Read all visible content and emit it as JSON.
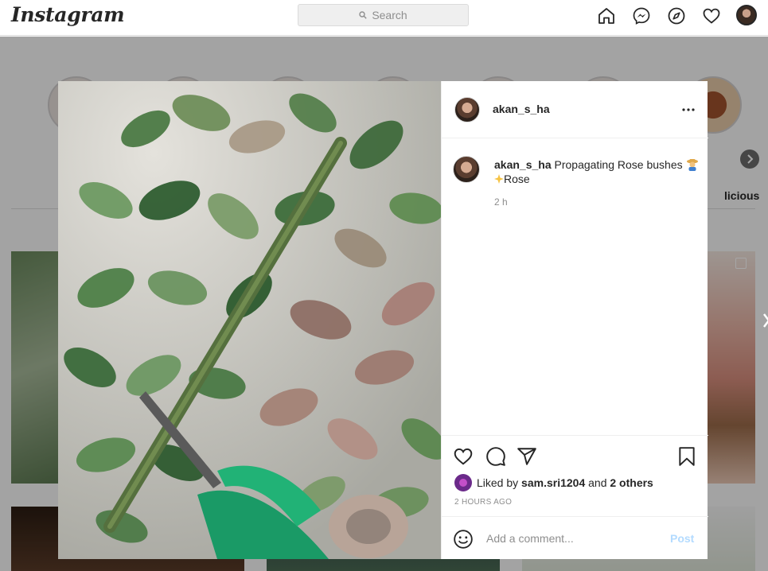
{
  "header": {
    "logo": "Instagram",
    "search_placeholder": "Search",
    "icons": [
      "home-icon",
      "messenger-icon",
      "explore-icon",
      "heart-icon",
      "profile-avatar"
    ]
  },
  "stories": {
    "partial_label": "licious"
  },
  "post": {
    "username": "akan_s_ha",
    "caption": {
      "username": "akan_s_ha",
      "text": "Propagating Rose bushes",
      "emoji1": "farmer-emoji",
      "line2": "Rose",
      "emoji2": "sparkles-emoji",
      "time": "2 h"
    },
    "likes": {
      "prefix": "Liked by",
      "user": "sam.sri1204",
      "and": "and",
      "others": "2 others"
    },
    "posted_ago": "2 HOURS AGO",
    "comment": {
      "placeholder": "Add a comment...",
      "post_label": "Post"
    }
  },
  "colors": {
    "link_disabled": "#b3dbff",
    "secondary_text": "#8e8e8e",
    "border": "#dbdbdb"
  }
}
